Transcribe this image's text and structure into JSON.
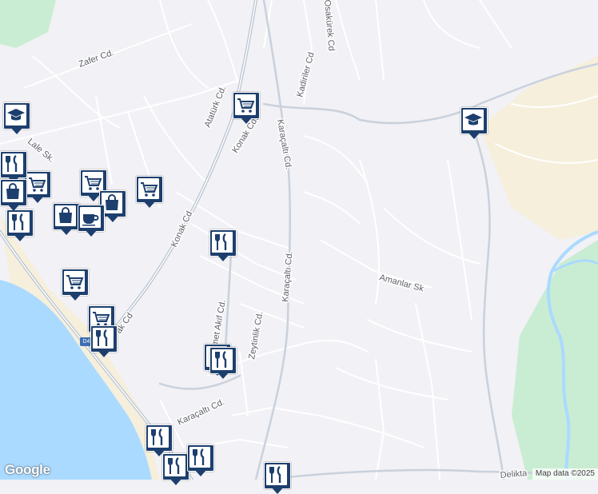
{
  "map": {
    "colors": {
      "land": "#f2f1f5",
      "water": "#aadaff",
      "park": "#c9edd2",
      "sand": "#f5efdc",
      "road": "#ffffff",
      "major_road": "#b9c3d0",
      "pin": "#1d3f6e"
    },
    "road_labels": [
      {
        "text": "Zafer Cd."
      },
      {
        "text": "Atatürk Cd."
      },
      {
        "text": "Konak Cd."
      },
      {
        "text": "Konak Cd"
      },
      {
        "text": "Lale Sk."
      },
      {
        "text": "Karaçaltı Cd."
      },
      {
        "text": "Kadiriler Cd"
      },
      {
        "text": "Osakürek Cd"
      },
      {
        "text": "Karaçaltı Cd."
      },
      {
        "text": "Amanlar Sk"
      },
      {
        "text": "Zeytinlik Cd."
      },
      {
        "text": "Mehmet Akif Cd."
      },
      {
        "text": "Karaçaltı Cd."
      },
      {
        "text": "ak Cd"
      },
      {
        "text": "Delikta"
      }
    ],
    "route_shield": "D4",
    "pins": [
      {
        "type": "school",
        "icon": "graduation-cap-icon"
      },
      {
        "type": "school",
        "icon": "graduation-cap-icon"
      },
      {
        "type": "supermarket",
        "icon": "cart-icon"
      },
      {
        "type": "supermarket",
        "icon": "cart-icon"
      },
      {
        "type": "supermarket",
        "icon": "cart-icon"
      },
      {
        "type": "supermarket",
        "icon": "cart-icon"
      },
      {
        "type": "supermarket",
        "icon": "cart-icon"
      },
      {
        "type": "supermarket",
        "icon": "cart-icon"
      },
      {
        "type": "restaurant",
        "icon": "fork-knife-icon"
      },
      {
        "type": "restaurant",
        "icon": "fork-knife-icon"
      },
      {
        "type": "restaurant",
        "icon": "fork-knife-icon"
      },
      {
        "type": "restaurant",
        "icon": "fork-knife-icon"
      },
      {
        "type": "restaurant",
        "icon": "fork-knife-icon"
      },
      {
        "type": "restaurant",
        "icon": "fork-knife-icon"
      },
      {
        "type": "restaurant",
        "icon": "fork-knife-icon"
      },
      {
        "type": "restaurant",
        "icon": "fork-knife-icon"
      },
      {
        "type": "restaurant",
        "icon": "fork-knife-icon"
      },
      {
        "type": "restaurant",
        "icon": "fork-knife-icon"
      },
      {
        "type": "shopping",
        "icon": "shopping-bag-icon"
      },
      {
        "type": "shopping",
        "icon": "shopping-bag-icon"
      },
      {
        "type": "shopping",
        "icon": "shopping-bag-icon"
      },
      {
        "type": "cafe",
        "icon": "coffee-cup-icon"
      }
    ],
    "logo": "Google",
    "attribution": "Map data ©2025"
  }
}
